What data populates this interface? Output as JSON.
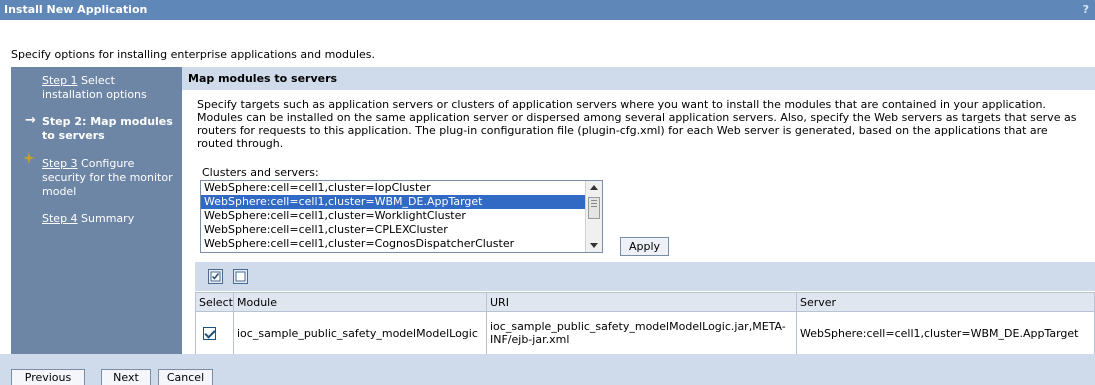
{
  "window": {
    "title": "Install New Application",
    "help_glyph": "?"
  },
  "intro": "Specify options for installing enterprise applications and modules.",
  "steps": [
    {
      "num": "Step 1",
      "text": " Select installation options"
    },
    {
      "title": "Step 2: Map modules to servers"
    },
    {
      "num": "Step 3",
      "text": " Configure security for the monitor model"
    },
    {
      "num": "Step 4",
      "text": " Summary"
    }
  ],
  "section": {
    "title": "Map modules to servers",
    "description": "Specify targets such as application servers or clusters of application servers where you want to install the modules that are contained in your application. Modules can be installed on the same application server or dispersed among several application servers. Also, specify the Web servers as targets that serve as routers for requests to this application. The plug-in configuration file (plugin-cfg.xml) for each Web server is generated, based on the applications that are routed through."
  },
  "clusters": {
    "label": "Clusters and servers:",
    "options": [
      "WebSphere:cell=cell1,cluster=IopCluster",
      "WebSphere:cell=cell1,cluster=WBM_DE.AppTarget",
      "WebSphere:cell=cell1,cluster=WorklightCluster",
      "WebSphere:cell=cell1,cluster=CPLEXCluster",
      "WebSphere:cell=cell1,cluster=CognosDispatcherCluster"
    ],
    "selected": "WebSphere:cell=cell1,cluster=WBM_DE.AppTarget"
  },
  "apply_label": "Apply",
  "table": {
    "headers": [
      "Select",
      "Module",
      "URI",
      "Server"
    ],
    "rows": [
      {
        "checked": true,
        "module": "ioc_sample_public_safety_modelModelLogic",
        "uri": "ioc_sample_public_safety_modelModelLogic.jar,META-INF/ejb-jar.xml",
        "server": "WebSphere:cell=cell1,cluster=WBM_DE.AppTarget"
      }
    ]
  },
  "buttons": {
    "previous": "Previous",
    "next": "Next",
    "cancel": "Cancel"
  },
  "colors": {
    "title_bar": "#5f87b8",
    "sidebar": "#6e86a6",
    "panel": "#a9bbd6",
    "header": "#cfdaea",
    "selection": "#316ac5"
  }
}
